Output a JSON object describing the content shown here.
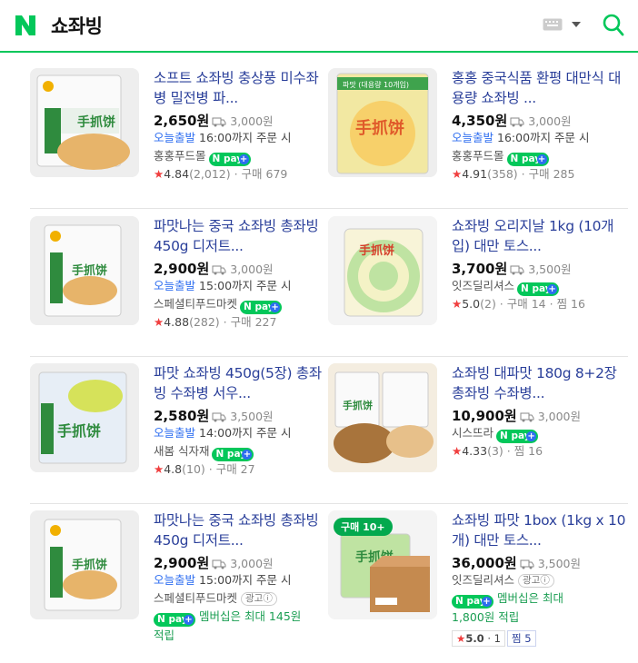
{
  "header": {
    "query": "쇼좌빙",
    "logo_letter": "N",
    "brand_color": "#03c75a",
    "icons": [
      "naver-logo-icon",
      "keyboard-icon",
      "caret-down-icon",
      "search-icon"
    ]
  },
  "products": [
    {
      "title": "소프트 쇼좌빙 충상풍 미수좌병 밀전병 파...",
      "price": "2,650원",
      "shipping": "3,000원",
      "delivery_today": "오늘출발",
      "delivery_rest": "16:00까지 주문 시",
      "store": "홍홍푸드몰",
      "star": "★",
      "rating": "4.84",
      "reviews": "(2,012)",
      "purchases": "구매 679",
      "thumb_label": "手抓饼"
    },
    {
      "title": "홍홍 중국식품 환평 대만식 대용량 쇼좌빙 ...",
      "price": "4,350원",
      "shipping": "3,000원",
      "delivery_today": "오늘출발",
      "delivery_rest": "16:00까지 주문 시",
      "store": "홍홍푸드몰",
      "star": "★",
      "rating": "4.91",
      "reviews": "(358)",
      "purchases": "구매 285",
      "thumb_label": "手抓饼",
      "thumb_top": "파맛 (대용량 10개입)"
    },
    {
      "title": "파맛나는 중국 쇼좌빙 총좌빙 450g 디저트...",
      "price": "2,900원",
      "shipping": "3,000원",
      "delivery_today": "오늘출발",
      "delivery_rest": "15:00까지 주문 시",
      "store": "스페셜티푸드마켓",
      "star": "★",
      "rating": "4.88",
      "reviews": "(282)",
      "purchases": "구매 227",
      "thumb_label": "手抓饼"
    },
    {
      "title": "쇼좌빙 오리지날 1kg (10개입) 대만 토스...",
      "price": "3,700원",
      "shipping": "3,500원",
      "store": "잇즈딜리셔스",
      "star": "★",
      "rating": "5.0",
      "reviews": "(2)",
      "purchases": "구매 14",
      "jjim": "찜 16",
      "thumb_label": "手抓饼"
    },
    {
      "title": "파맛 쇼좌빙 450g(5장) 총좌빙 수좌병 서우...",
      "price": "2,580원",
      "shipping": "3,500원",
      "delivery_today": "오늘출발",
      "delivery_rest": "14:00까지 주문 시",
      "store": "새봄 식자재",
      "star": "★",
      "rating": "4.8",
      "reviews": "(10)",
      "purchases": "구매 27",
      "thumb_label": "手抓饼"
    },
    {
      "title": "쇼좌빙 대파맛 180g 8+2장 총좌빙 수좌병...",
      "price": "10,900원",
      "shipping": "3,000원",
      "store": "시스뜨라",
      "star": "★",
      "rating": "4.33",
      "reviews": "(3)",
      "jjim": "찜 16",
      "thumb_label": "手抓饼"
    },
    {
      "title": "파맛나는 중국 쇼좌빙 총좌빙 450g 디저트...",
      "price": "2,900원",
      "shipping": "3,000원",
      "delivery_today": "오늘출발",
      "delivery_rest": "15:00까지 주문 시",
      "store": "스페셜티푸드마켓",
      "ad": "광고ⓘ",
      "membership": "멤버십은 최대 145원",
      "membership2": "적립",
      "thumb_label": "手抓饼"
    },
    {
      "title": "쇼좌빙 파맛 1box (1kg x 10개) 대만 토스...",
      "price": "36,000원",
      "shipping": "3,500원",
      "store": "잇즈딜리셔스",
      "ad": "광고ⓘ",
      "membership": "멤버십은 최대",
      "membership2": "1,800원 적립",
      "box_rating": "5.0",
      "box_count": "1",
      "box_jjim": "찜 5",
      "buy_tag": "구매 10+",
      "thumb_label": "手抓饼"
    }
  ],
  "npay": {
    "label": "N pay",
    "plus": "+"
  }
}
